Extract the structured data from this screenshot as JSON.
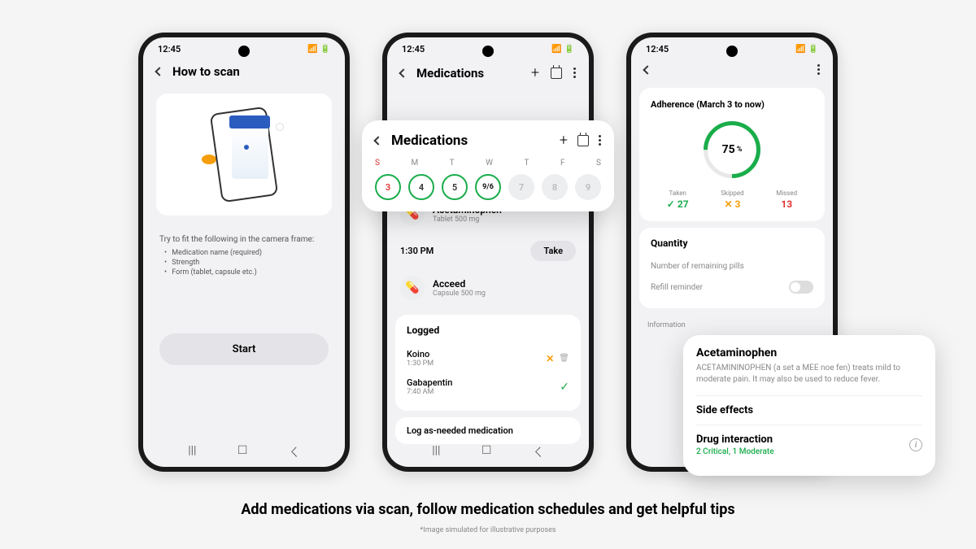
{
  "status": {
    "time": "12:45"
  },
  "phone1": {
    "title": "How to scan",
    "instructions_title": "Try to fit the following in the camera frame:",
    "instructions": [
      "Medication name (required)",
      "Strength",
      "Form (tablet, capsule etc.)"
    ],
    "start": "Start"
  },
  "phone2": {
    "title": "Medications",
    "overlay_title": "Medications",
    "days": [
      "S",
      "M",
      "T",
      "W",
      "T",
      "F",
      "S"
    ],
    "dates": [
      "3",
      "4",
      "5",
      "9/6",
      "7",
      "8",
      "9"
    ],
    "med1": {
      "name": "Acetaminophen",
      "detail": "Tablet 500 mg"
    },
    "time1": "1:30 PM",
    "take": "Take",
    "med2": {
      "name": "Acceed",
      "detail": "Capsule 500 mg"
    },
    "logged_title": "Logged",
    "log1": {
      "name": "Koino",
      "time": "1:30 PM"
    },
    "log2": {
      "name": "Gabapentin",
      "time": "7:40 AM"
    },
    "log_button": "Log as-needed medication"
  },
  "phone3": {
    "adherence_title": "Adherence (March 3 to now)",
    "percent": "75",
    "percent_unit": "%",
    "stats": {
      "taken": {
        "label": "Taken",
        "value": "27",
        "icon": "✓"
      },
      "skipped": {
        "label": "Skipped",
        "value": "3",
        "icon": "✕"
      },
      "missed": {
        "label": "Missed",
        "value": "13"
      }
    },
    "quantity_title": "Quantity",
    "qty_remaining": "Number of remaining pills",
    "refill": "Refill reminder",
    "info_label": "Information"
  },
  "info_overlay": {
    "title": "Acetaminophen",
    "desc": "ACETAMININOPHEN (a set a MEE noe fen) treats mild to moderate pain. It may also be used to reduce fever.",
    "side_effects": "Side effects",
    "drug_int": "Drug interaction",
    "int_detail": "2 Critical, 1 Moderate"
  },
  "caption": "Add medications via scan, follow medication schedules and get helpful tips",
  "disclaimer": "*Image simulated for illustrative purposes"
}
